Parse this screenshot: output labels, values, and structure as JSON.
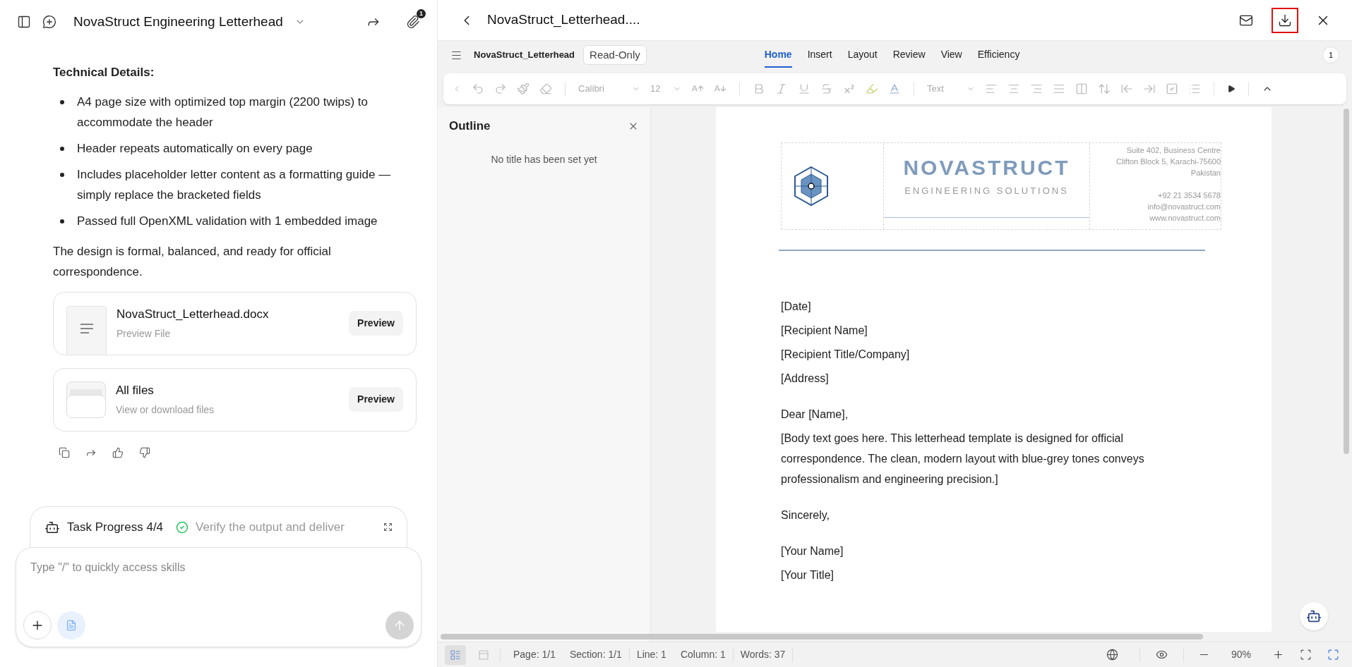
{
  "chat": {
    "title": "NovaStruct Engineering Letterhead",
    "attachment_badge": "1",
    "heading": "Technical Details:",
    "bullets": [
      "A4 page size with optimized top margin (2200 twips) to accommodate the header",
      "Header repeats automatically on every page",
      "Includes placeholder letter content as a formatting guide — simply replace the bracketed fields",
      "Passed full OpenXML validation with 1 embedded image"
    ],
    "paragraph": "The design is formal, balanced, and ready for official correspondence.",
    "files": [
      {
        "kind": "document",
        "name": "NovaStruct_Letterhead.docx",
        "subtitle": "Preview File",
        "button": "Preview"
      },
      {
        "kind": "folder",
        "name": "All files",
        "subtitle": "View or download files",
        "button": "Preview"
      }
    ],
    "task_progress": {
      "label": "Task Progress 4/4",
      "step": "Verify the output and deliver",
      "done": true
    },
    "composer": {
      "placeholder": "Type \"/\" to quickly access skills"
    }
  },
  "preview": {
    "title": "NovaStruct_Letterhead....",
    "download_highlighted": true,
    "doc_name": "NovaStruct_Letterhead",
    "mode": "Read-Only",
    "tabs": [
      {
        "label": "Home",
        "selected": true
      },
      {
        "label": "Insert",
        "selected": false
      },
      {
        "label": "Layout",
        "selected": false
      },
      {
        "label": "Review",
        "selected": false
      },
      {
        "label": "View",
        "selected": false
      },
      {
        "label": "Efficiency",
        "selected": false
      }
    ],
    "comment_count": "1",
    "toolbar": {
      "font": "Calibri",
      "size": "12",
      "style": "Text"
    },
    "outline": {
      "title": "Outline",
      "empty": "No title has been set yet"
    },
    "letterhead": {
      "company": "NOVASTRUCT",
      "tagline": "ENGINEERING SOLUTIONS",
      "address": [
        "Suite 402, Business Centre",
        "Clifton Block 5, Karachi-75600",
        "Pakistan"
      ],
      "contact": [
        "+92 21 3534 5678",
        "info@novastruct.com",
        "www.novastruct.com"
      ]
    },
    "letter": [
      [
        "[Date]",
        "[Recipient Name]",
        "[Recipient Title/Company]",
        "[Address]"
      ],
      [
        "Dear [Name],",
        "[Body text goes here. This letterhead template is designed for official correspondence. The clean, modern layout with blue-grey tones conveys professionalism and engineering precision.]"
      ],
      [
        "Sincerely,"
      ],
      [
        "[Your Name]",
        "[Your Title]"
      ]
    ],
    "status_bar": {
      "items": [
        "Page: 1/1",
        "Section: 1/1",
        "Line: 1",
        "Column: 1",
        "Words: 37"
      ],
      "zoom": "90%"
    }
  }
}
